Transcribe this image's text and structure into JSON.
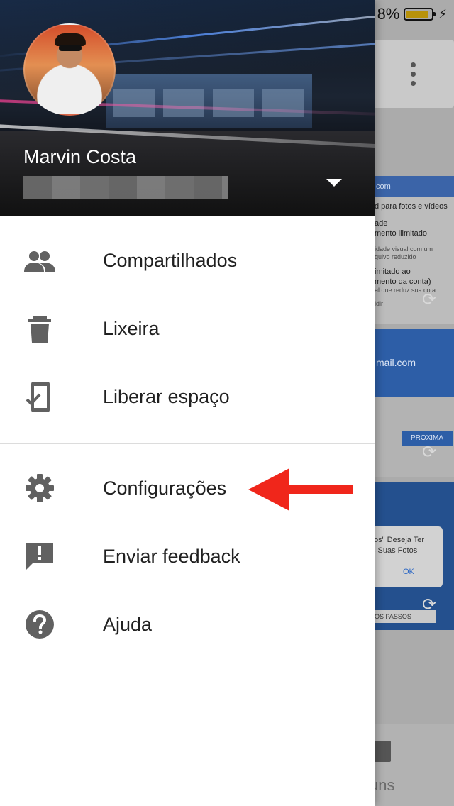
{
  "status_bar": {
    "battery_text": "8%"
  },
  "drawer": {
    "account": {
      "name": "Marvin Costa"
    },
    "menu_group_1": [
      {
        "label": "Compartilhados",
        "icon": "people-icon"
      },
      {
        "label": "Lixeira",
        "icon": "trash-icon"
      },
      {
        "label": "Liberar espaço",
        "icon": "phone-check-icon"
      }
    ],
    "menu_group_2": [
      {
        "label": "Configurações",
        "icon": "gear-icon"
      },
      {
        "label": "Enviar feedback",
        "icon": "feedback-icon"
      },
      {
        "label": "Ajuda",
        "icon": "help-icon"
      }
    ]
  },
  "background": {
    "card1": {
      "header": "com",
      "lines": [
        "d para fotos e vídeos",
        "ade",
        "mento ilimitado"
      ],
      "small": [
        "idade visual com um",
        "quivo reduzido"
      ],
      "lines2": [
        "imitado ao",
        "mento da conta)"
      ],
      "small2": "al que reduz sua cota",
      "link": "idir"
    },
    "card2": {
      "email": "mail.com",
      "button": "PRÓXIMA"
    },
    "card3": {
      "dialog_line1": "tos\" Deseja Ter",
      "dialog_line2": "s Suas Fotos",
      "ok": "OK",
      "steps": "OS PASSOS"
    },
    "bottom_tab": "uns"
  },
  "colors": {
    "annotation_arrow": "#f0261b",
    "accent_blue": "#2d5ea7",
    "icon_gray": "#616161"
  }
}
